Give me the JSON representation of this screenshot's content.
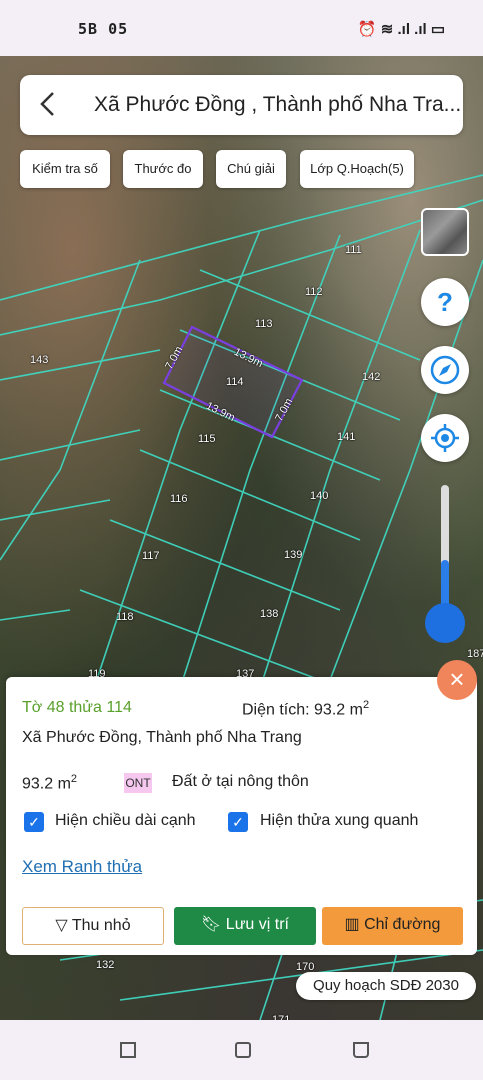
{
  "status_bar": {
    "left_text": "5B 05",
    "right_text": "⏰ ≋ .ıl .ıl ▭"
  },
  "header": {
    "back_icon": "chevron-left-icon",
    "title": "Xã Phước Đồng , Thành phố Nha Tra..."
  },
  "toolbar": {
    "chips": [
      "Kiểm tra số",
      "Thước đo",
      "Chú giải",
      "Lớp Q.Hoạch(5)"
    ]
  },
  "map": {
    "lot_numbers": [
      "111",
      "112",
      "113",
      "114",
      "143",
      "142",
      "115",
      "141",
      "116",
      "140",
      "117",
      "139",
      "118",
      "138",
      "119",
      "137",
      "132",
      "170",
      "171",
      "187"
    ],
    "edge_labels": {
      "top": "13.9m",
      "bottom": "13.9m",
      "left": "7.0m",
      "right": "7.0m"
    }
  },
  "side_controls": {
    "help": "?",
    "compass_icon": "compass-icon",
    "locate_icon": "crosshair-icon",
    "zoom_level": 0.35
  },
  "panel": {
    "lot_text": "Tờ 48 thửa 114",
    "area_label": "Diện tích: 93.2 m",
    "area_sup": "2",
    "address": "Xã Phước Đồng, Thành phố Nha Trang",
    "area_value": "93.2 m",
    "area_value_sup": "2",
    "land_code": "ONT",
    "land_type": "Đất ở tại nông thôn",
    "checkbox_edges": "Hiện chiều dài cạnh",
    "checkbox_neighbors": "Hiện thửa xung quanh",
    "link": "Xem Ranh thửa",
    "btn_shrink": "Thu nhỏ",
    "btn_save": "Lưu vị trí",
    "btn_directions": "Chỉ đường",
    "close": "×"
  },
  "plan_pill": "Quy hoạch SDĐ 2030",
  "colors": {
    "accent": "#1e88e5",
    "save": "#1f8a45",
    "directions": "#f39a3c",
    "lot": "#5aa02c",
    "parcel": "#3fd6c0",
    "selected": "#7a3fe0"
  }
}
